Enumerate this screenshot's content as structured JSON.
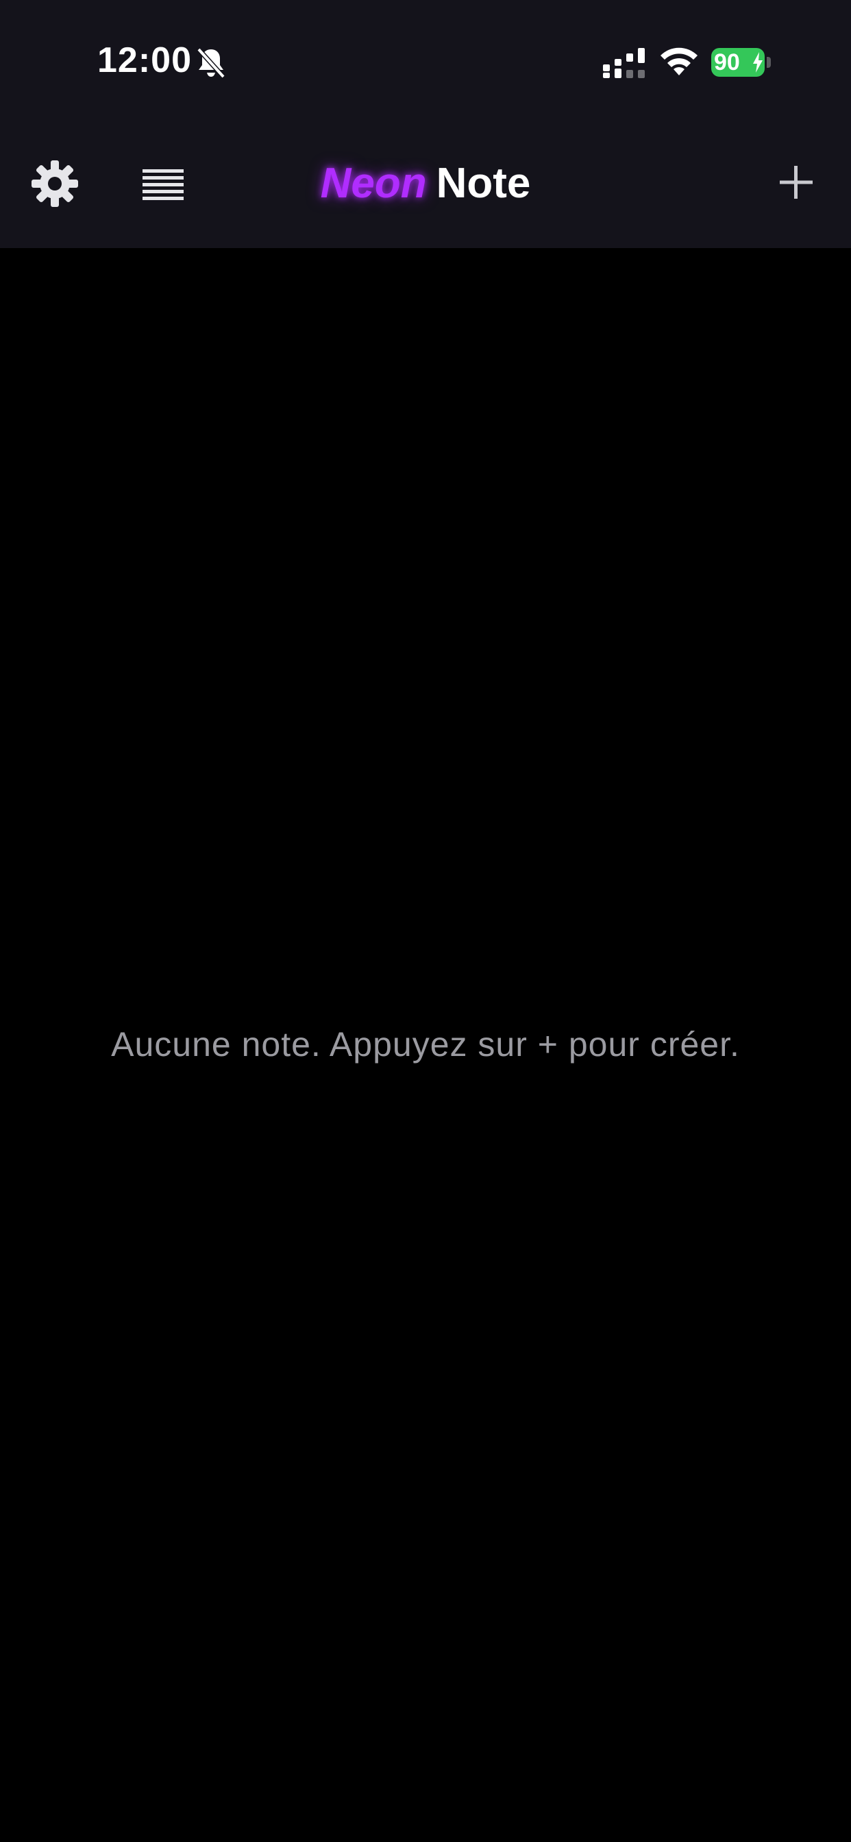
{
  "status_bar": {
    "time": "12:00",
    "battery_level": "90",
    "battery_color": "#34c759",
    "icons": [
      "bell-off-icon",
      "signal-icon",
      "wifi-icon",
      "battery-icon"
    ]
  },
  "header": {
    "title_accent": "Neon",
    "title_rest": "Note",
    "accent_color": "#b02dff",
    "left_buttons": [
      "gear-icon",
      "list-icon"
    ],
    "right_buttons": [
      "plus-icon"
    ]
  },
  "main": {
    "empty_message": "Aucune note. Appuyez sur + pour créer."
  }
}
